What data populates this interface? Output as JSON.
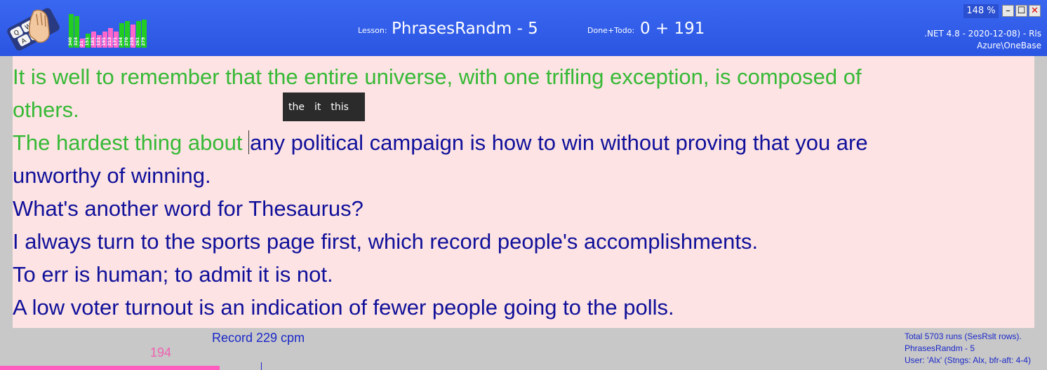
{
  "header": {
    "lesson_label": "Lesson:",
    "lesson_value": "PhrasesRandm - 5",
    "done_label": "Done+Todo:",
    "done_value": "0 + 191",
    "zoom": "148 %",
    "window_buttons": {
      "minimize": "–",
      "maximize": "☐",
      "close": "✕"
    },
    "build_line1": ".NET 4.8 - 2020-12-08) - Rls",
    "build_line2": "Azure\\OneBase"
  },
  "mini_chart": {
    "bars": [
      {
        "value": "340",
        "color": "#22cc22",
        "level": 0.95
      },
      {
        "value": "324",
        "color": "#22cc22",
        "level": 0.9
      },
      {
        "value": "21",
        "color": "#ff66cc",
        "level": 0.25
      },
      {
        "value": "151",
        "color": "#22cc22",
        "level": 0.4
      },
      {
        "value": "181",
        "color": "#ff66cc",
        "level": 0.45
      },
      {
        "value": "121",
        "color": "#ff66cc",
        "level": 0.35
      },
      {
        "value": "191",
        "color": "#ff66cc",
        "level": 0.45
      },
      {
        "value": "213",
        "color": "#ff66cc",
        "level": 0.55
      },
      {
        "value": "171",
        "color": "#ff66cc",
        "level": 0.45
      },
      {
        "value": "244",
        "color": "#22cc22",
        "level": 0.7
      },
      {
        "value": "270",
        "color": "#22cc22",
        "level": 0.75
      },
      {
        "value": "235",
        "color": "#ff66cc",
        "level": 0.65
      },
      {
        "value": "261",
        "color": "#22cc22",
        "level": 0.75
      },
      {
        "value": "279",
        "color": "#22cc22",
        "level": 0.8
      }
    ]
  },
  "text": {
    "line1_done": "It is well to remember that the entire universe, with one trifling exception, is composed of",
    "line2_done": "others.",
    "line3_done": "The hardest thing about ",
    "line3_todo": "any political campaign is how to win without proving that you are",
    "line4": "unworthy of winning.",
    "line5": "What's another word for Thesaurus?",
    "line6": "I always turn to the sports page first, which record people's accomplishments.",
    "line7": "To err is human; to admit it is not.",
    "line8": "A low voter turnout is an indication of fewer people going to the polls."
  },
  "suggestions": [
    "the",
    "it",
    "this"
  ],
  "footer": {
    "record": "Record 229 cpm",
    "speed_value": "194",
    "speed_fraction": 0.21,
    "stats_line1": "Total 5703 runs (SesRslt rows).",
    "stats_line2": "PhrasesRandm - 5",
    "stats_line3": "User: 'Alx' (Stngs: Alx,  bfr-aft: 4-4)"
  }
}
